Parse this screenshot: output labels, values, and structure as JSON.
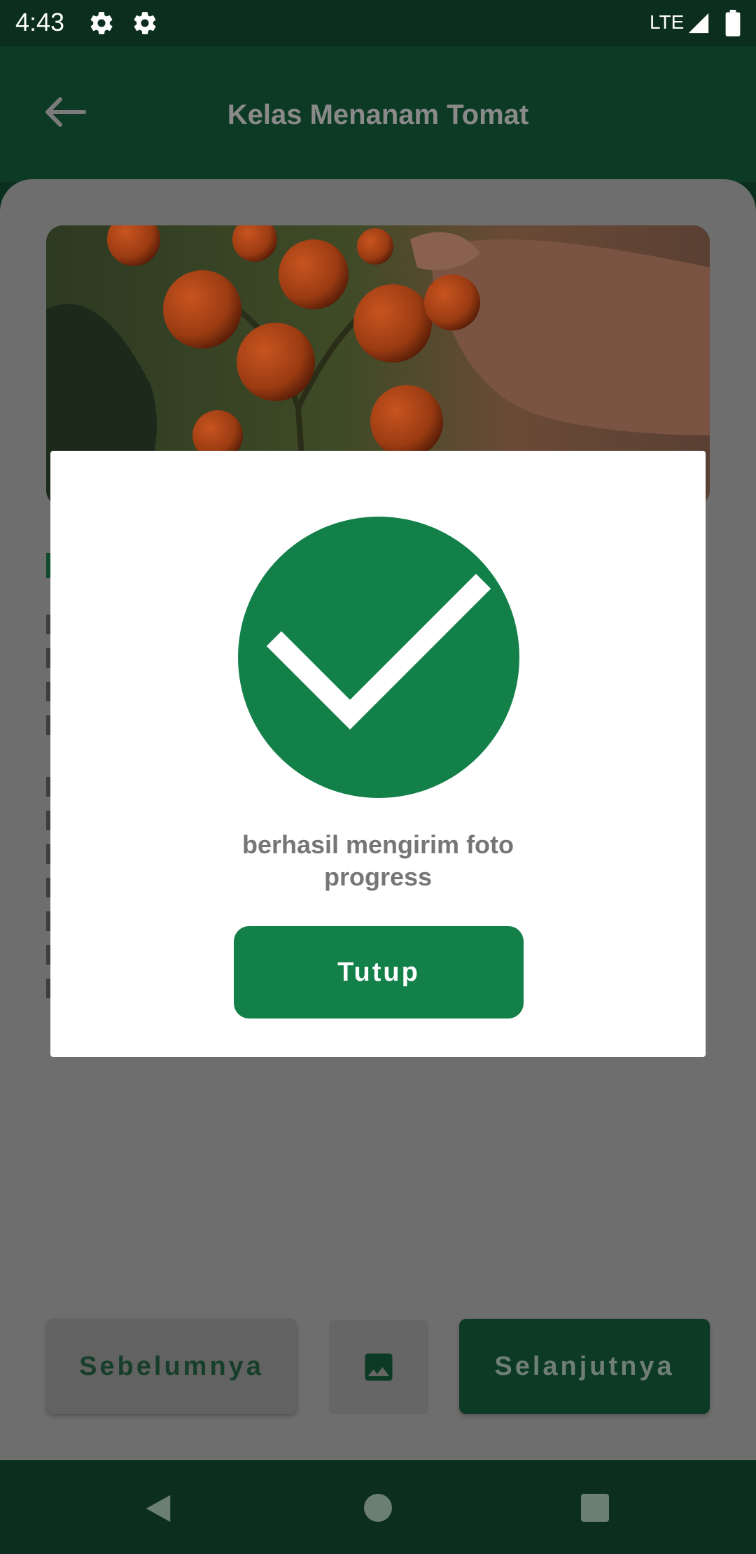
{
  "status_bar": {
    "time": "4:43",
    "network": "LTE",
    "icons": [
      "settings-icon",
      "settings-icon",
      "signal-icon",
      "battery-icon"
    ]
  },
  "app_bar": {
    "title": "Kelas Menanam Tomat",
    "back_icon": "arrow-left-icon"
  },
  "hero_image": {
    "subject": "tomato plant photo"
  },
  "bottom_actions": {
    "prev_label": "Sebelumnya",
    "gallery_icon": "image-icon",
    "next_label": "Selanjutnya"
  },
  "dialog": {
    "icon": "check-circle-icon",
    "message_line1": "berhasil mengirim foto",
    "message_line2": "progress",
    "close_label": "Tutup"
  },
  "nav_bar": {
    "icons": [
      "back-triangle-icon",
      "home-circle-icon",
      "recents-square-icon"
    ]
  },
  "colors": {
    "primary_green": "#13804a",
    "dark_green": "#0c3a24",
    "scrim": "#6e6e6e",
    "dialog_bg": "#ffffff"
  }
}
